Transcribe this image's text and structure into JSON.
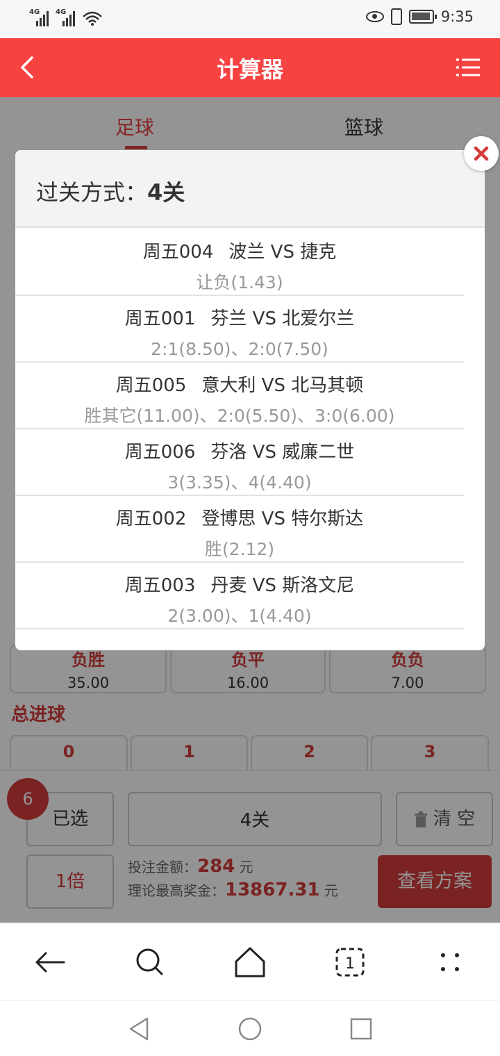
{
  "status": {
    "signal1": "4G",
    "signal2": "4G",
    "time": "9:35"
  },
  "header": {
    "title": "计算器"
  },
  "tabs": [
    {
      "label": "足球"
    },
    {
      "label": "篮球"
    }
  ],
  "background": {
    "odds_row": [
      {
        "label": "负胜",
        "value": "35.00"
      },
      {
        "label": "负平",
        "value": "16.00"
      },
      {
        "label": "负负",
        "value": "7.00"
      }
    ],
    "goals_title": "总进球",
    "goals": [
      "0",
      "1",
      "2",
      "3"
    ]
  },
  "bottom": {
    "badge_count": "6",
    "selected_label": "已选",
    "pass_value": "4关",
    "clear_label": "清 空",
    "multiple_label": "1倍",
    "bet_amount_label": "投注金额：",
    "bet_amount": "284",
    "bet_unit": "元",
    "max_prize_label": "理论最高奖金：",
    "max_prize": "13867.31",
    "max_prize_unit": "元",
    "view_plan_label": "查看方案"
  },
  "modal": {
    "title_prefix": "过关方式：",
    "title_value": "4关",
    "matches": [
      {
        "num": "周五004",
        "teams": "波兰 VS 捷克",
        "odds": "让负(1.43)"
      },
      {
        "num": "周五001",
        "teams": "芬兰 VS 北爱尔兰",
        "odds": "2:1(8.50)、2:0(7.50)"
      },
      {
        "num": "周五005",
        "teams": "意大利 VS 北马其顿",
        "odds": "胜其它(11.00)、2:0(5.50)、3:0(6.00)"
      },
      {
        "num": "周五006",
        "teams": "芬洛 VS 威廉二世",
        "odds": "3(3.35)、4(4.40)"
      },
      {
        "num": "周五002",
        "teams": "登博思 VS 特尔斯达",
        "odds": "胜(2.12)"
      },
      {
        "num": "周五003",
        "teams": "丹麦 VS 斯洛文尼",
        "odds": "2(3.00)、1(4.40)"
      }
    ]
  },
  "colors": {
    "brand_red": "#f74242",
    "accent_red": "#d43b3b"
  }
}
